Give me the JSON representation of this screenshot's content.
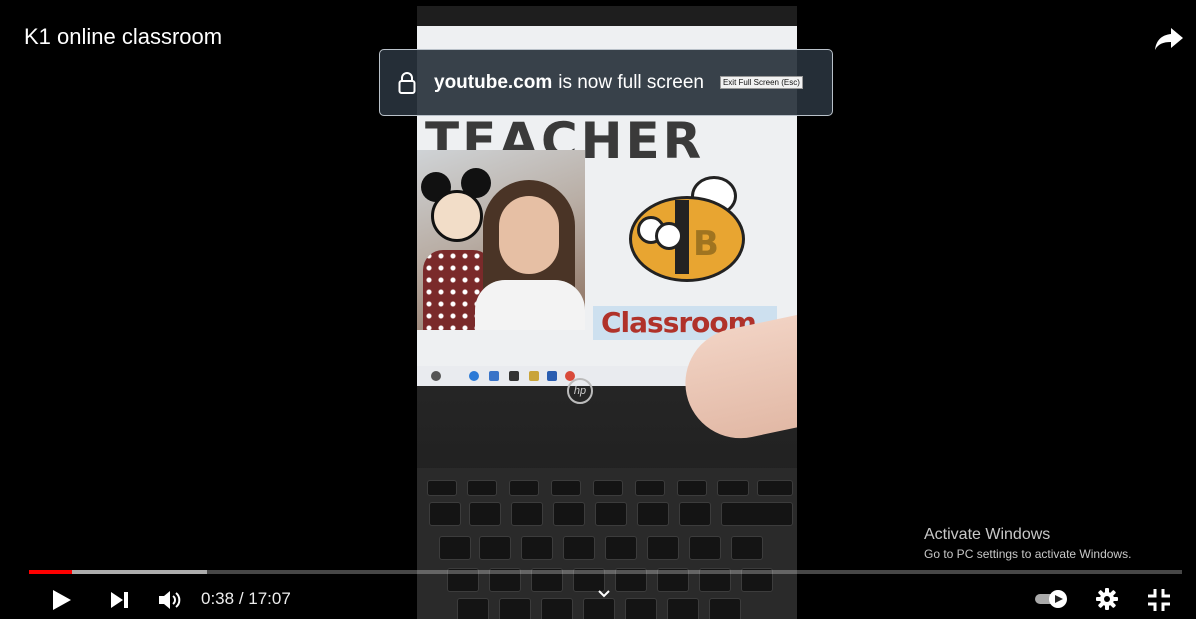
{
  "video": {
    "title": "K1 online classroom",
    "current_time": "0:38",
    "duration": "17:07",
    "time_separator": " / ",
    "progress_played": 0.037,
    "progress_buffered": 0.154,
    "accent_color": "#ff0000"
  },
  "fullscreen_notice": {
    "domain": "youtube.com",
    "message": "is now full screen",
    "exit_label": "Exit Full Screen (Esc)"
  },
  "overlay_text": {
    "activate_title": "Activate Windows",
    "activate_subtitle": "Go to PC settings to activate Windows."
  },
  "in_video_text": {
    "teacher": "TEACHER",
    "bee_letter": "B",
    "classroom": "Classroom"
  },
  "icons": {
    "play": "play-icon",
    "next": "next-icon",
    "volume": "volume-icon",
    "share": "share-icon",
    "lock": "lock-icon",
    "autoplay": "autoplay-toggle-icon",
    "settings": "gear-icon",
    "exit_fullscreen": "exit-fullscreen-icon",
    "chevron": "chevron-down-icon"
  }
}
